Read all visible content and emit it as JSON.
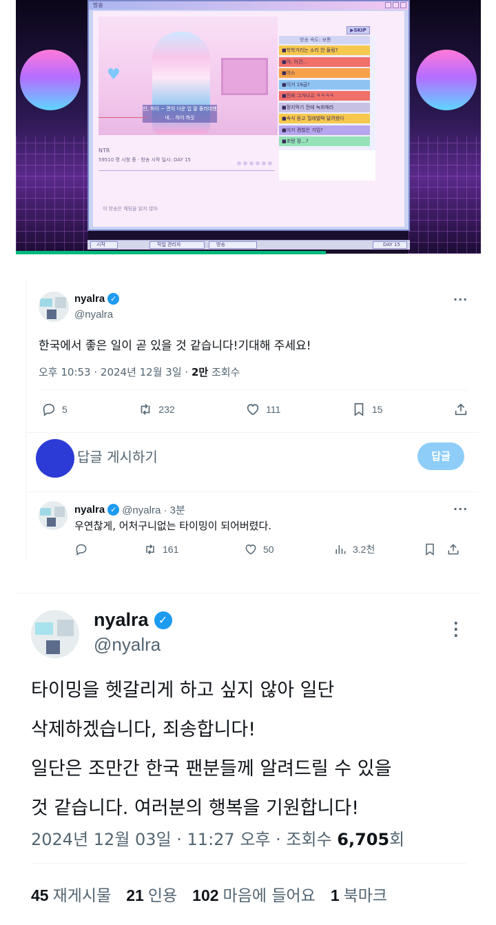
{
  "game": {
    "window_title": "방송",
    "stream_title": "NTR",
    "stream_info": "59510 명 시청 중 · 방송 시작 일시: DAY 15",
    "subtitle": "안, 하이 ~ 편히 다운 입 팔 좋러대했네... 하이 하웃",
    "speed_label": "방송 속도: 보통",
    "skip_label": "▶SKIP",
    "footer_note": "이 방송은 체팅을 읽지 않아",
    "chat_messages": [
      {
        "text": "■학학거리는 소리 안 들림?",
        "color": "#f7c84e"
      },
      {
        "text": "■아, 이건...",
        "color": "#f0706a"
      },
      {
        "text": "■이스",
        "color": "#f7a24a"
      },
      {
        "text": "■이거 19금?",
        "color": "#8fc4f2"
      },
      {
        "text": "■진짜 그거나고 ㅋㅋㅋㅋ",
        "color": "#f0706a"
      },
      {
        "text": "■정지먹기 전에 녹화해라",
        "color": "#c7c2e4"
      },
      {
        "text": "■속식 듣고 헐레벌떡 달려왔다",
        "color": "#f7c84e"
      },
      {
        "text": "■이거 괜찮은 거임?",
        "color": "#b7a7ee"
      },
      {
        "text": "■초텐 장...?",
        "color": "#94e3b7"
      }
    ],
    "taskbar_start": "시작",
    "taskbar_tasks": [
      "작업 관리자",
      "방송"
    ],
    "taskbar_day": "DAY 15"
  },
  "tweet1": {
    "display_name": "nyalra",
    "handle": "@nyalra",
    "text": "한국에서 좋은 일이 곧 있을 것 같습니다!기대해 주세요!",
    "meta_time": "오후 10:53 · 2024년 12월 3일 · ",
    "meta_views_count": "2만",
    "meta_views_label": " 조회수",
    "replies": "5",
    "retweets": "232",
    "likes": "111",
    "bookmarks": "15"
  },
  "composer": {
    "placeholder": "답글 게시하기",
    "button": "답글"
  },
  "reply": {
    "display_name": "nyalra",
    "handle_time": "@nyalra · 3분",
    "text": "우연찮게, 어처구니없는 타이밍이 되어버렸다.",
    "replies": "",
    "retweets": "161",
    "likes": "50",
    "views": "3.2천"
  },
  "tweet2": {
    "display_name": "nyalra",
    "handle": "@nyalra",
    "text_lines": [
      "타이밍을 헷갈리게 하고 싶지 않아 일단",
      "삭제하겠습니다, 죄송합니다!",
      "일단은 조만간 한국 팬분들께 알려드릴 수 있을",
      "것 같습니다. 여러분의 행복을 기원합니다!"
    ],
    "meta_prefix": "2024년 12월 03일 · 11:27 오후 · 조회수 ",
    "meta_views": "6,705",
    "meta_suffix": "회",
    "stats": [
      {
        "count": "45",
        "label": "재게시물"
      },
      {
        "count": "21",
        "label": "인용"
      },
      {
        "count": "102",
        "label": "마음에 들어요"
      },
      {
        "count": "1",
        "label": "북마크"
      }
    ]
  },
  "colors": {
    "accent": "#1d9bf0",
    "progress_green": "#00ba7c",
    "reply_button": "#8ecdf8",
    "composer_avatar": "#2c3bd6"
  },
  "icons": {
    "more": "more-icon",
    "reply": "reply-icon",
    "retweet": "retweet-icon",
    "like": "heart-icon",
    "bookmark": "bookmark-icon",
    "share": "share-icon",
    "views": "views-icon",
    "verified": "verified-icon"
  }
}
